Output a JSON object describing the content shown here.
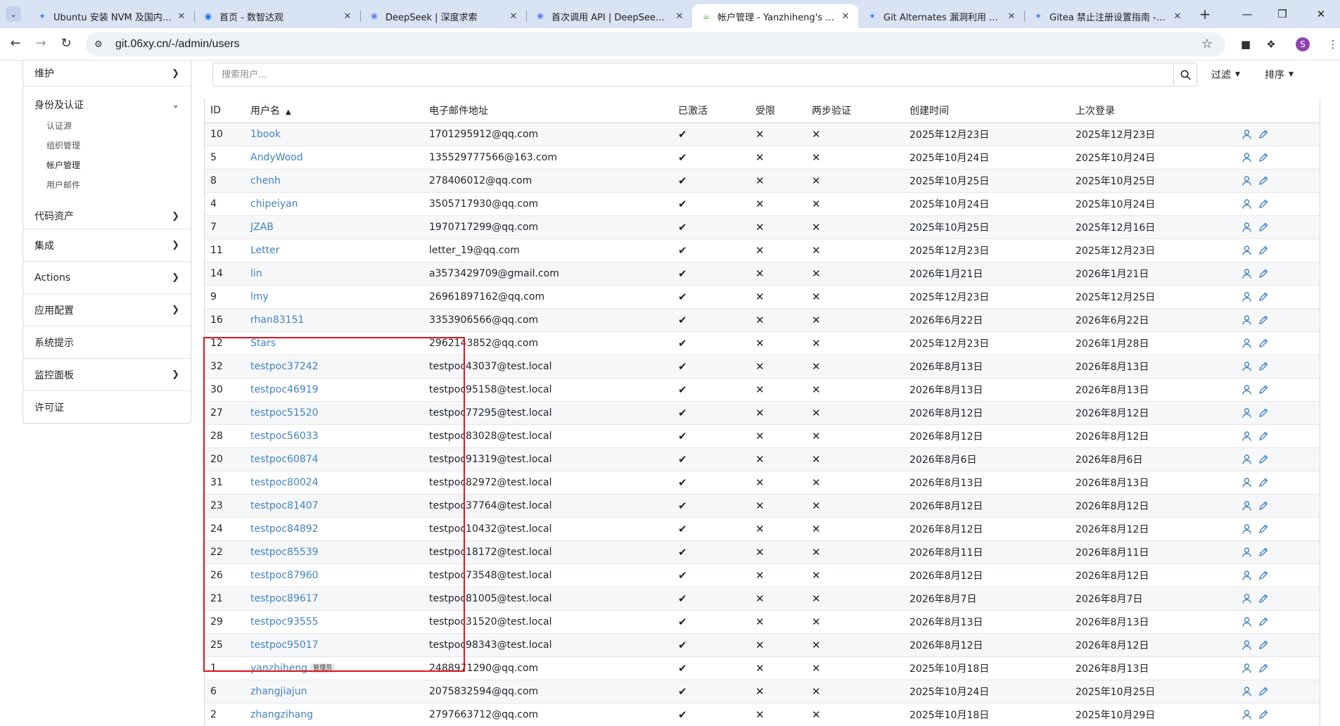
{
  "browser": {
    "tabs": [
      {
        "title": "Ubuntu 安装 NVM 及国内镜像",
        "favicon": "gemini-icon",
        "color": "#4285f4",
        "active": false
      },
      {
        "title": "首页 - 数智达观",
        "favicon": "globe-icon",
        "color": "#1a73e8",
        "active": false
      },
      {
        "title": "DeepSeek | 深度求索",
        "favicon": "deepseek-icon",
        "color": "#4d6bfe",
        "active": false
      },
      {
        "title": "首次调用 API | DeepSeek API",
        "favicon": "deepseek-icon",
        "color": "#4d6bfe",
        "active": false
      },
      {
        "title": "帐户管理 - Yanzhiheng's Gitea",
        "favicon": "gitea-icon",
        "color": "#609926",
        "active": true
      },
      {
        "title": "Git Alternates 漏洞利用 PoC 实",
        "favicon": "gemini-icon",
        "color": "#4285f4",
        "active": false
      },
      {
        "title": "Gitea 禁止注册设置指南 - Goo",
        "favicon": "gemini-icon",
        "color": "#4285f4",
        "active": false
      }
    ],
    "url": "git.06xy.cn/-/admin/users",
    "profile_initial": "S"
  },
  "sidebar": {
    "top_item": "维护",
    "expanded": {
      "label": "身份及认证",
      "children": [
        "认证源",
        "组织管理",
        "帐户管理",
        "用户邮件"
      ],
      "active": "帐户管理"
    },
    "items": [
      {
        "label": "代码资产",
        "chevron": true
      },
      {
        "label": "集成",
        "chevron": true
      },
      {
        "label": "Actions",
        "chevron": true
      },
      {
        "label": "应用配置",
        "chevron": true
      },
      {
        "label": "系统提示",
        "chevron": false
      },
      {
        "label": "监控面板",
        "chevron": true
      },
      {
        "label": "许可证",
        "chevron": false
      }
    ]
  },
  "search": {
    "placeholder": "搜索用户..."
  },
  "filters": {
    "filter_label": "过滤",
    "sort_label": "排序"
  },
  "table": {
    "columns": [
      "ID",
      "用户名",
      "电子邮件地址",
      "已激活",
      "受限",
      "两步验证",
      "创建时间",
      "上次登录"
    ],
    "admin_badge": "管理员",
    "rows": [
      {
        "id": "10",
        "username": "1book",
        "email": "1701295912@qq.com",
        "created": "2025年12月23日",
        "last_login": "2025年12月23日"
      },
      {
        "id": "5",
        "username": "AndyWood",
        "email": "135529777566@163.com",
        "created": "2025年10月24日",
        "last_login": "2025年10月24日"
      },
      {
        "id": "8",
        "username": "chenh",
        "email": "278406012@qq.com",
        "created": "2025年10月25日",
        "last_login": "2025年10月25日"
      },
      {
        "id": "4",
        "username": "chipeiyan",
        "email": "3505717930@qq.com",
        "created": "2025年10月24日",
        "last_login": "2025年10月24日"
      },
      {
        "id": "7",
        "username": "JZAB",
        "email": "1970717299@qq.com",
        "created": "2025年10月25日",
        "last_login": "2025年12月16日"
      },
      {
        "id": "11",
        "username": "Letter",
        "email": "letter_19@qq.com",
        "created": "2025年12月23日",
        "last_login": "2025年12月23日"
      },
      {
        "id": "14",
        "username": "lin",
        "email": "a3573429709@gmail.com",
        "created": "2026年1月21日",
        "last_login": "2026年1月21日"
      },
      {
        "id": "9",
        "username": "lmy",
        "email": "26961897162@qq.com",
        "created": "2025年12月23日",
        "last_login": "2025年12月25日"
      },
      {
        "id": "16",
        "username": "rhan83151",
        "email": "3353906566@qq.com",
        "created": "2026年6月22日",
        "last_login": "2026年6月22日"
      },
      {
        "id": "12",
        "username": "Stars",
        "email": "2962143852@qq.com",
        "created": "2025年12月23日",
        "last_login": "2026年1月28日"
      },
      {
        "id": "32",
        "username": "testpoc37242",
        "email": "testpoc43037@test.local",
        "created": "2026年8月13日",
        "last_login": "2026年8月13日"
      },
      {
        "id": "30",
        "username": "testpoc46919",
        "email": "testpoc95158@test.local",
        "created": "2026年8月13日",
        "last_login": "2026年8月13日"
      },
      {
        "id": "27",
        "username": "testpoc51520",
        "email": "testpoc77295@test.local",
        "created": "2026年8月12日",
        "last_login": "2026年8月12日"
      },
      {
        "id": "28",
        "username": "testpoc56033",
        "email": "testpoc83028@test.local",
        "created": "2026年8月12日",
        "last_login": "2026年8月12日"
      },
      {
        "id": "20",
        "username": "testpoc60874",
        "email": "testpoc91319@test.local",
        "created": "2026年8月6日",
        "last_login": "2026年8月6日"
      },
      {
        "id": "31",
        "username": "testpoc80024",
        "email": "testpoc82972@test.local",
        "created": "2026年8月13日",
        "last_login": "2026年8月13日"
      },
      {
        "id": "23",
        "username": "testpoc81407",
        "email": "testpoc37764@test.local",
        "created": "2026年8月12日",
        "last_login": "2026年8月12日"
      },
      {
        "id": "24",
        "username": "testpoc84892",
        "email": "testpoc10432@test.local",
        "created": "2026年8月12日",
        "last_login": "2026年8月12日"
      },
      {
        "id": "22",
        "username": "testpoc85539",
        "email": "testpoc18172@test.local",
        "created": "2026年8月11日",
        "last_login": "2026年8月11日"
      },
      {
        "id": "26",
        "username": "testpoc87960",
        "email": "testpoc73548@test.local",
        "created": "2026年8月12日",
        "last_login": "2026年8月12日"
      },
      {
        "id": "21",
        "username": "testpoc89617",
        "email": "testpoc81005@test.local",
        "created": "2026年8月7日",
        "last_login": "2026年8月7日"
      },
      {
        "id": "29",
        "username": "testpoc93555",
        "email": "testpoc31520@test.local",
        "created": "2026年8月13日",
        "last_login": "2026年8月13日"
      },
      {
        "id": "25",
        "username": "testpoc95017",
        "email": "testpoc98343@test.local",
        "created": "2026年8月12日",
        "last_login": "2026年8月12日"
      },
      {
        "id": "1",
        "username": "yanzhiheng",
        "email": "2488971290@qq.com",
        "created": "2025年10月18日",
        "last_login": "2026年8月13日",
        "admin": true
      },
      {
        "id": "6",
        "username": "zhangjiajun",
        "email": "2075832594@qq.com",
        "created": "2025年10月24日",
        "last_login": "2025年10月25日"
      },
      {
        "id": "2",
        "username": "zhangzihang",
        "email": "2797663712@qq.com",
        "created": "2025年10月18日",
        "last_login": "2025年10月29日"
      }
    ]
  },
  "colors": {
    "link": "#4183c4",
    "highlight": "#e0141e",
    "tab_strip": "#d8e3f4"
  }
}
